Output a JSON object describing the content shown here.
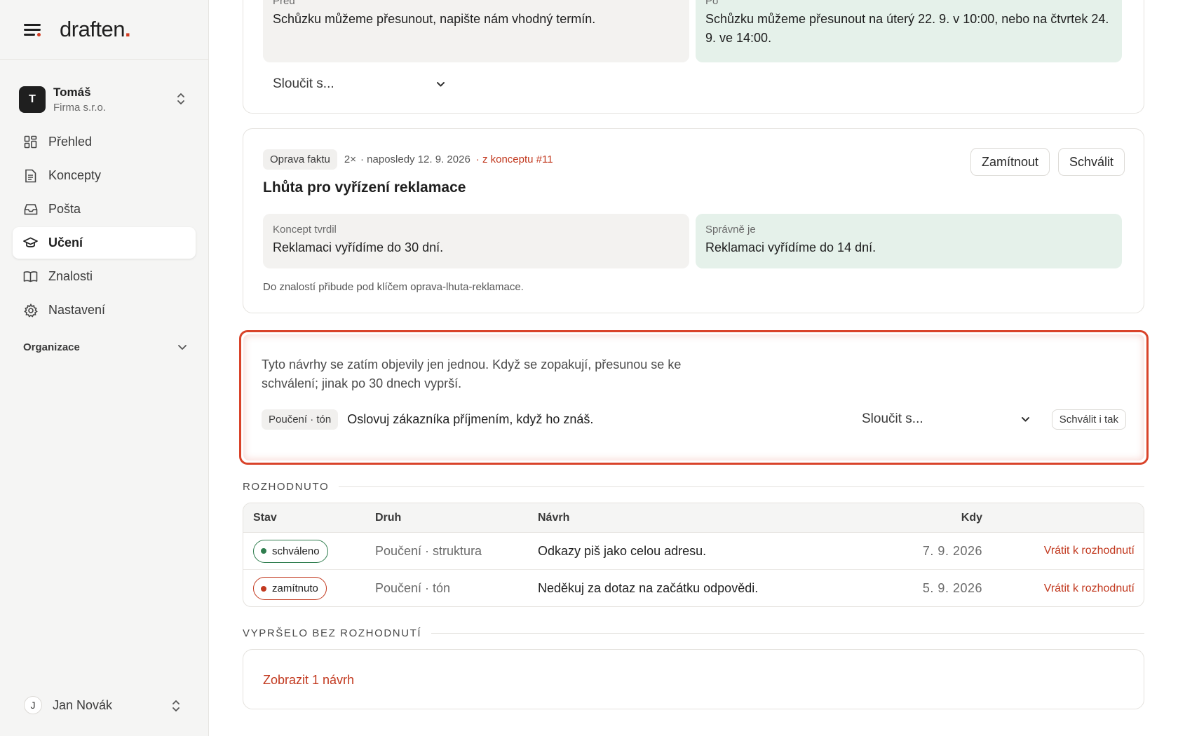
{
  "brand": {
    "name": "draften",
    "dot": "."
  },
  "account": {
    "initial": "T",
    "name": "Tomáš",
    "company": "Firma s.r.o."
  },
  "nav": [
    {
      "label": "Přehled",
      "icon": "dashboard-icon"
    },
    {
      "label": "Koncepty",
      "icon": "document-icon"
    },
    {
      "label": "Pošta",
      "icon": "inbox-icon"
    },
    {
      "label": "Učení",
      "icon": "graduation-cap-icon",
      "active": true
    },
    {
      "label": "Znalosti",
      "icon": "book-icon"
    },
    {
      "label": "Nastavení",
      "icon": "gear-icon"
    }
  ],
  "organization": {
    "label": "Organizace"
  },
  "user": {
    "initial": "J",
    "name": "Jan Novák"
  },
  "top_card": {
    "before_label": "Před",
    "before_text": "Schůzku můžeme přesunout, napište nám vhodný termín.",
    "after_label": "Po",
    "after_text": "Schůzku můžeme přesunout na úterý 22. 9. v 10:00, nebo na čtvrtek 24. 9. ve 14:00.",
    "merge_select": "Sloučit s..."
  },
  "fact_card": {
    "tag": "Oprava faktu",
    "count": "2×",
    "last": "· naposledy 12. 9. 2026",
    "source": "· z konceptu #11",
    "reject_label": "Zamítnout",
    "approve_label": "Schválit",
    "title": "Lhůta pro vyřízení reklamace",
    "claimed_label": "Koncept tvrdil",
    "claimed_text": "Reklamaci vyřídíme do 30 dní.",
    "correct_label": "Správně je",
    "correct_text": "Reklamaci vyřídíme do 14 dní.",
    "note": "Do znalostí přibude pod klíčem oprava-lhuta-reklamace."
  },
  "pending": {
    "description": "Tyto návrhy se zatím objevily jen jednou. Když se zopakují, přesunou se ke schválení; jinak po 30 dnech vyprší.",
    "tag": "Poučení · tón",
    "text": "Oslovuj zákazníka příjmením, když ho znáš.",
    "merge_select": "Sloučit s...",
    "approve_anyway": "Schválit i tak"
  },
  "decided": {
    "heading": "ROZHODNUTO",
    "columns": {
      "status": "Stav",
      "kind": "Druh",
      "proposal": "Návrh",
      "when": "Kdy"
    },
    "rows": [
      {
        "status": "schváleno",
        "status_type": "approved",
        "kind": "Poučení · struktura",
        "proposal": "Odkazy piš jako celou adresu.",
        "when": "7. 9. 2026",
        "action": "Vrátit k rozhodnutí"
      },
      {
        "status": "zamítnuto",
        "status_type": "rejected",
        "kind": "Poučení · tón",
        "proposal": "Neděkuj za dotaz na začátku odpovědi.",
        "when": "5. 9. 2026",
        "action": "Vrátit k rozhodnutí"
      }
    ]
  },
  "expired": {
    "heading": "VYPRŠELO BEZ ROZHODNUTÍ",
    "link": "Zobrazit 1 návrh"
  },
  "colors": {
    "accent": "#d23c22",
    "approved": "#2f7d4e",
    "rejected": "#c2391f",
    "success_bg": "#e5f1ea"
  }
}
